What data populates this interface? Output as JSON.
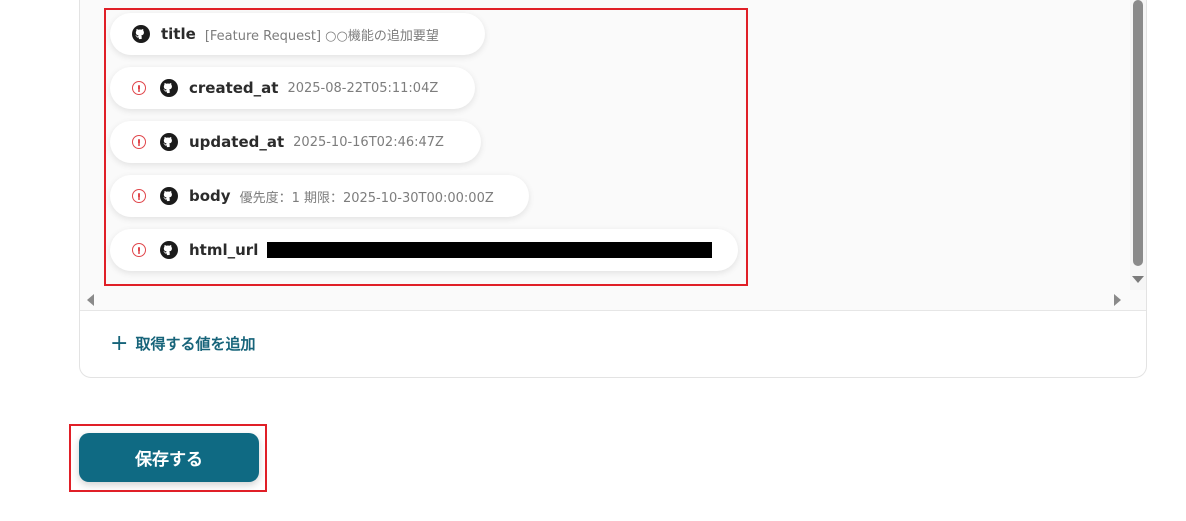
{
  "fields": [
    {
      "key": "title",
      "value": "[Feature Request] ○○機能の追加要望",
      "warning": false
    },
    {
      "key": "created_at",
      "value": "2025-08-22T05:11:04Z",
      "warning": true
    },
    {
      "key": "updated_at",
      "value": "2025-10-16T02:46:47Z",
      "warning": true
    },
    {
      "key": "body",
      "value": "優先度：1 期限：2025-10-30T00:00:00Z",
      "warning": true
    },
    {
      "key": "html_url",
      "value": "",
      "warning": true,
      "redacted": true
    }
  ],
  "add_value_label": "取得する値を追加",
  "save_label": "保存する",
  "icons": {
    "service": "github-icon",
    "warning": "warning-circle-icon",
    "add": "plus-icon"
  },
  "colors": {
    "accent": "#0f6a83",
    "link": "#17647a",
    "warning": "#e0464b",
    "highlight": "#e01f27"
  }
}
